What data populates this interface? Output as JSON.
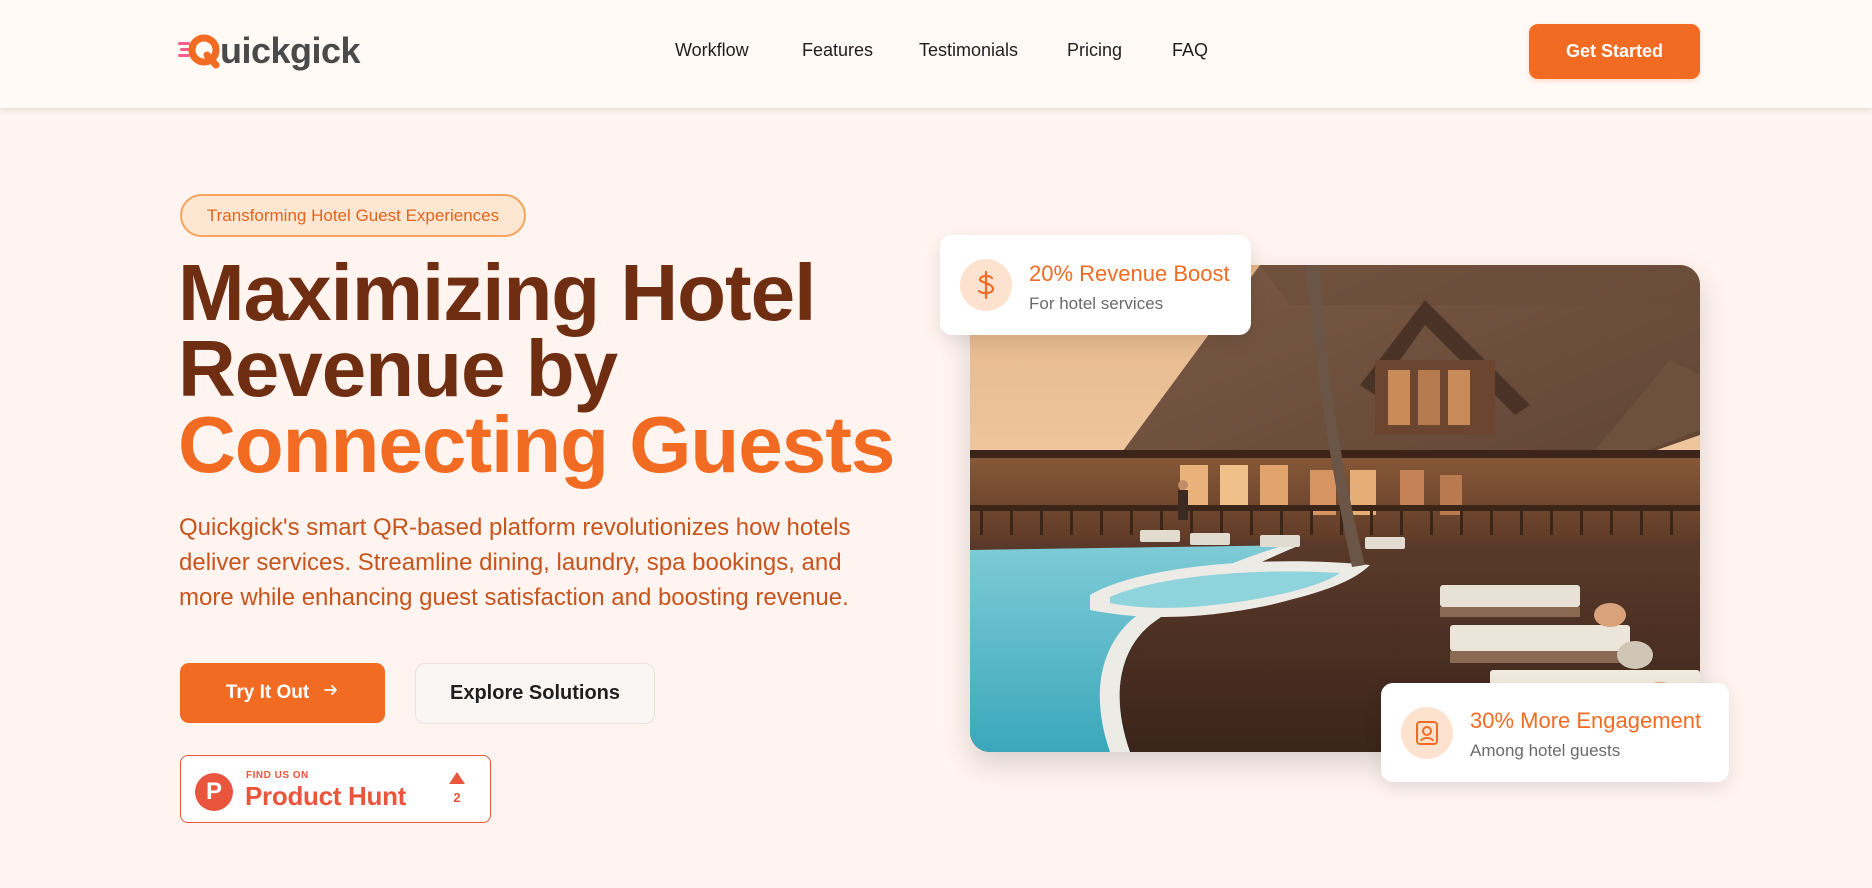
{
  "header": {
    "brand": "Quickgick",
    "brand_mark_letter": "Q",
    "brand_rest": "uickgick",
    "nav": [
      "Workflow",
      "Features",
      "Testimonials",
      "Pricing",
      "FAQ"
    ],
    "cta_label": "Get Started"
  },
  "hero": {
    "tag": "Transforming Hotel Guest Experiences",
    "headline_line1": "Maximizing Hotel",
    "headline_line2": "Revenue by",
    "headline_accent": "Connecting Guests",
    "description": "Quickgick's smart QR-based platform revolutionizes how hotels deliver services. Streamline dining, laundry, spa bookings, and more while enhancing guest satisfaction and boosting revenue.",
    "primary_button": "Try It Out",
    "secondary_button": "Explore Solutions",
    "product_hunt": {
      "small_text": "FIND US ON",
      "big_text": "Product Hunt",
      "logo_letter": "P",
      "upvotes": "2"
    }
  },
  "stats": [
    {
      "title": "20% Revenue Boost",
      "subtitle": "For hotel services",
      "icon": "dollar-icon"
    },
    {
      "title": "30% More Engagement",
      "subtitle": "Among hotel guests",
      "icon": "user-portrait-icon"
    }
  ],
  "colors": {
    "accent": "#f26b22",
    "headline_dark": "#6f2e12",
    "page_bg": "#fff4ef",
    "product_hunt": "#e9553d"
  }
}
